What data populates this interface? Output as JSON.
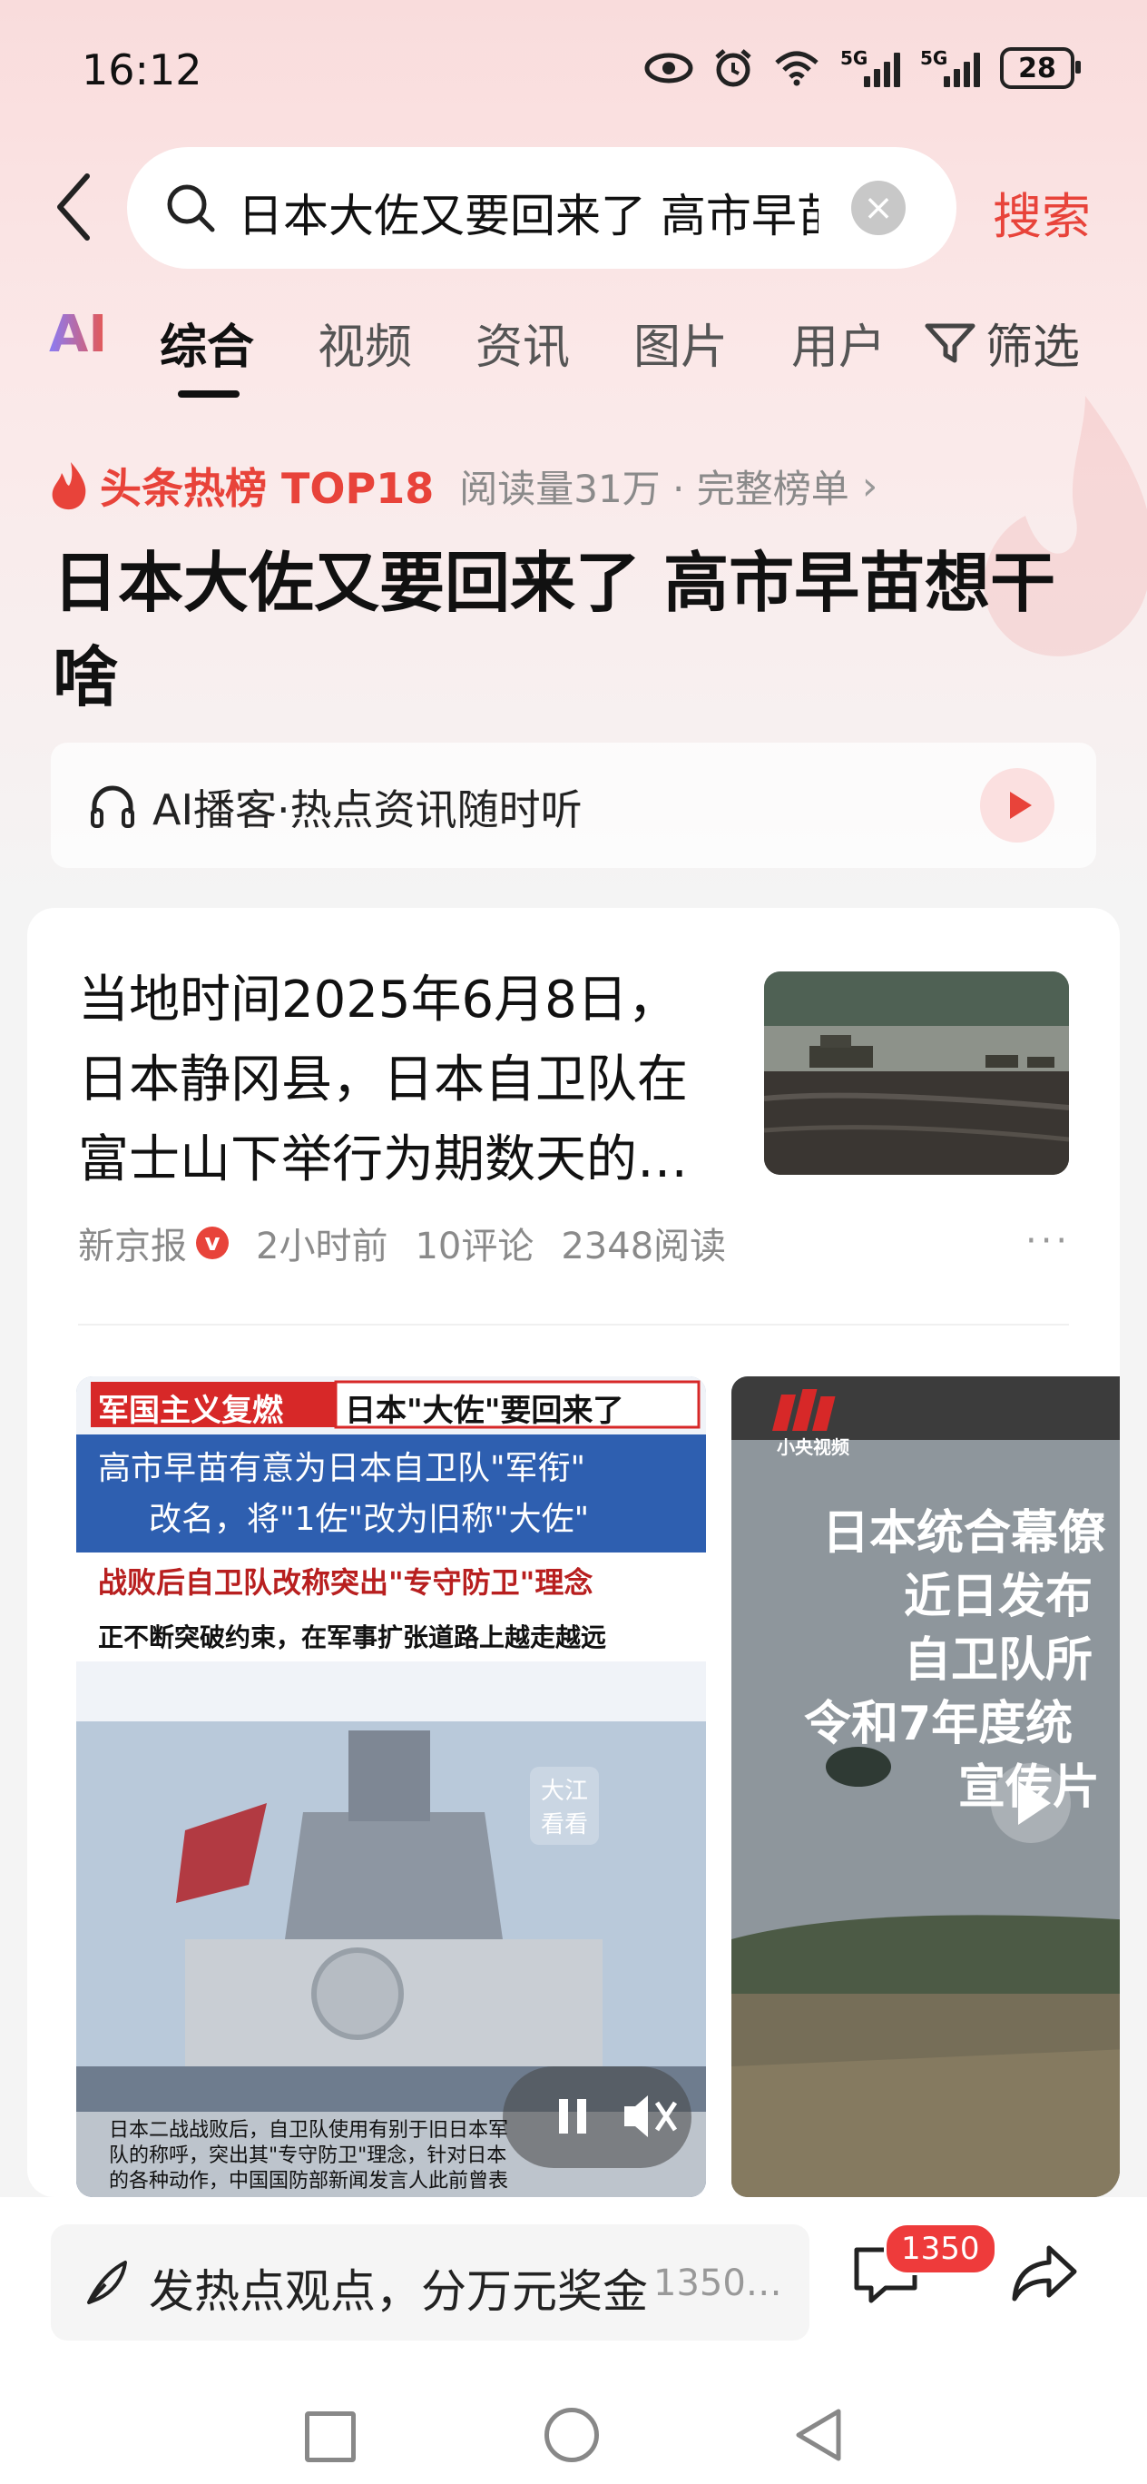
{
  "status_bar": {
    "time": "16:12",
    "signal1_label": "5G",
    "signal2_label": "5G",
    "battery": "28"
  },
  "search": {
    "query": "日本大佐又要回来了 高市早苗想干啥",
    "button_label": "搜索"
  },
  "tabs": [
    {
      "label": "AI"
    },
    {
      "label": "综合"
    },
    {
      "label": "视频"
    },
    {
      "label": "资讯"
    },
    {
      "label": "图片"
    },
    {
      "label": "用户"
    }
  ],
  "filter_label": "筛选",
  "hot_rank": {
    "rank_label": "头条热榜 TOP18",
    "meta": "阅读量31万 · 完整榜单"
  },
  "headline": "日本大佐又要回来了 高市早苗想干啥",
  "podcast": {
    "label": "AI播客·热点资讯随时听"
  },
  "article": {
    "lines": [
      "当地时间2025年6月8日，",
      "日本静冈县，日本自卫队在",
      "富士山下举行为期数天的…"
    ],
    "source": "新京报",
    "verified_mark": "v",
    "time": "2小时前",
    "comments": "10评论",
    "reads": "2348阅读"
  },
  "video1": {
    "banner_tag": "军国主义复燃",
    "banner_title": "日本\"大佐\"要回来了",
    "sub1": "高市早苗有意为日本自卫队\"军衔\"",
    "sub2": "改名，将\"1佐\"改为旧称\"大佐\"",
    "sub3": "战败后自卫队改称突出\"专守防卫\"理念",
    "sub4": "正不断突破约束，在军事扩张道路上越走越远",
    "watermark": "大江看看",
    "caption1": "日本二战战败后，自卫队使用有别于旧日本军",
    "caption2": "队的称呼，突出其\"专守防卫\"理念，针对日本",
    "caption3": "的各种动作，中国国防部新闻发言人此前曾表"
  },
  "video2": {
    "logo_text": "小央视频",
    "lines": [
      "日本统合幕僚",
      "近日发布",
      "自卫队所",
      "令和7年度统",
      "宣传片"
    ]
  },
  "bottom": {
    "comment_placeholder": "发热点观点，分万元奖金",
    "comment_count_preview": "1350…",
    "comment_badge": "1350"
  }
}
